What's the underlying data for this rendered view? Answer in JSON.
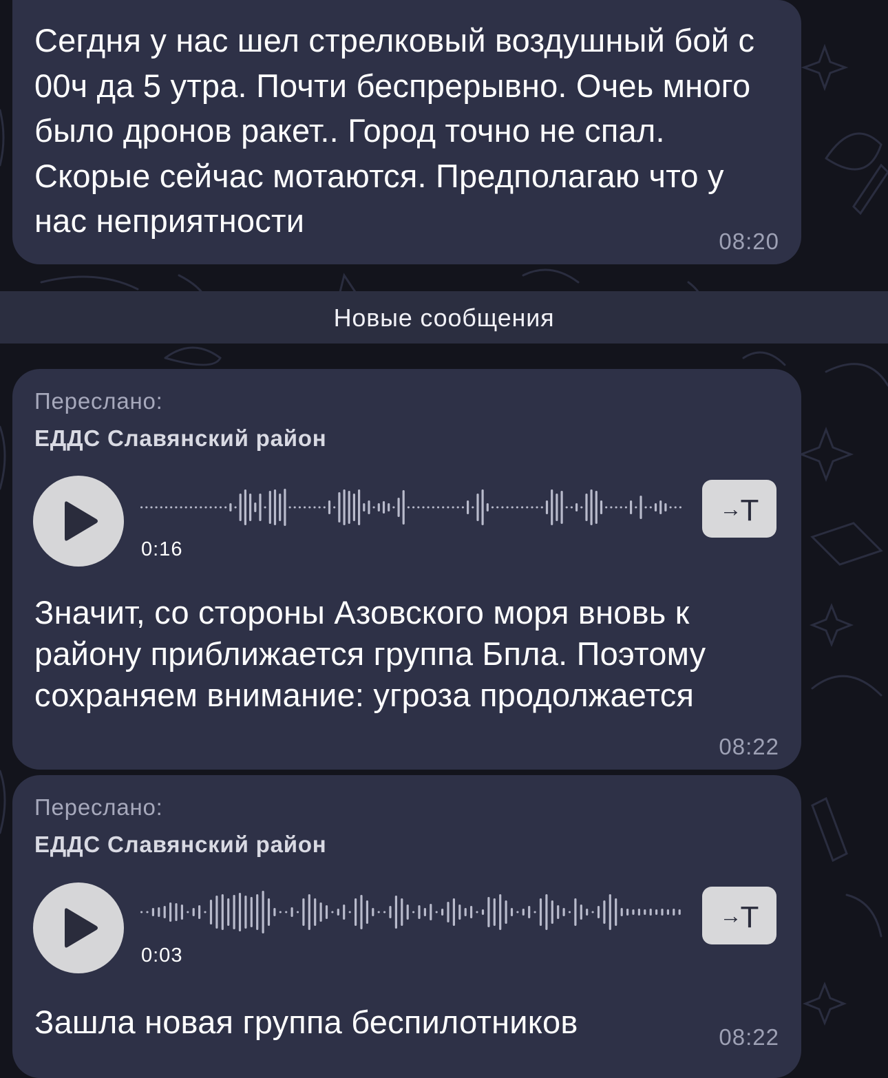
{
  "theme": {
    "background": "#13141c",
    "bubble": "#2e3147",
    "divider_bg": "#2b2e40",
    "time_color": "#9ea1b5",
    "play_button": "#d6d6d8"
  },
  "messages": [
    {
      "text": "Сегдня у нас шел стрелковый воздушный бой с 00ч да 5 утра. Почти беспрерывно. Очеь много было дронов ракет.. Город точно не спал. Скорые сейчас мотаются. Предполагаю что у нас неприятности",
      "time": "08:20"
    },
    {
      "forwarded_label": "Переслано:",
      "forwarded_from": "ЕДДС Славянский район",
      "voice": {
        "duration": "0:16",
        "play_icon": "play-icon",
        "transcribe_label": "T",
        "transcribe_icon": "arrow-right-icon"
      },
      "text": "Значит, со стороны Азовского моря вновь к району приближается группа Бпла. Поэтому сохраняем внимание: угроза продолжается",
      "time": "08:22"
    },
    {
      "forwarded_label": "Переслано:",
      "forwarded_from": "ЕДДС Славянский район",
      "voice": {
        "duration": "0:03",
        "play_icon": "play-icon",
        "transcribe_label": "T",
        "transcribe_icon": "arrow-right-icon"
      },
      "text": "Зашла новая группа беспилотников",
      "time": "08:22"
    }
  ],
  "new_messages_divider": "Новые сообщения"
}
